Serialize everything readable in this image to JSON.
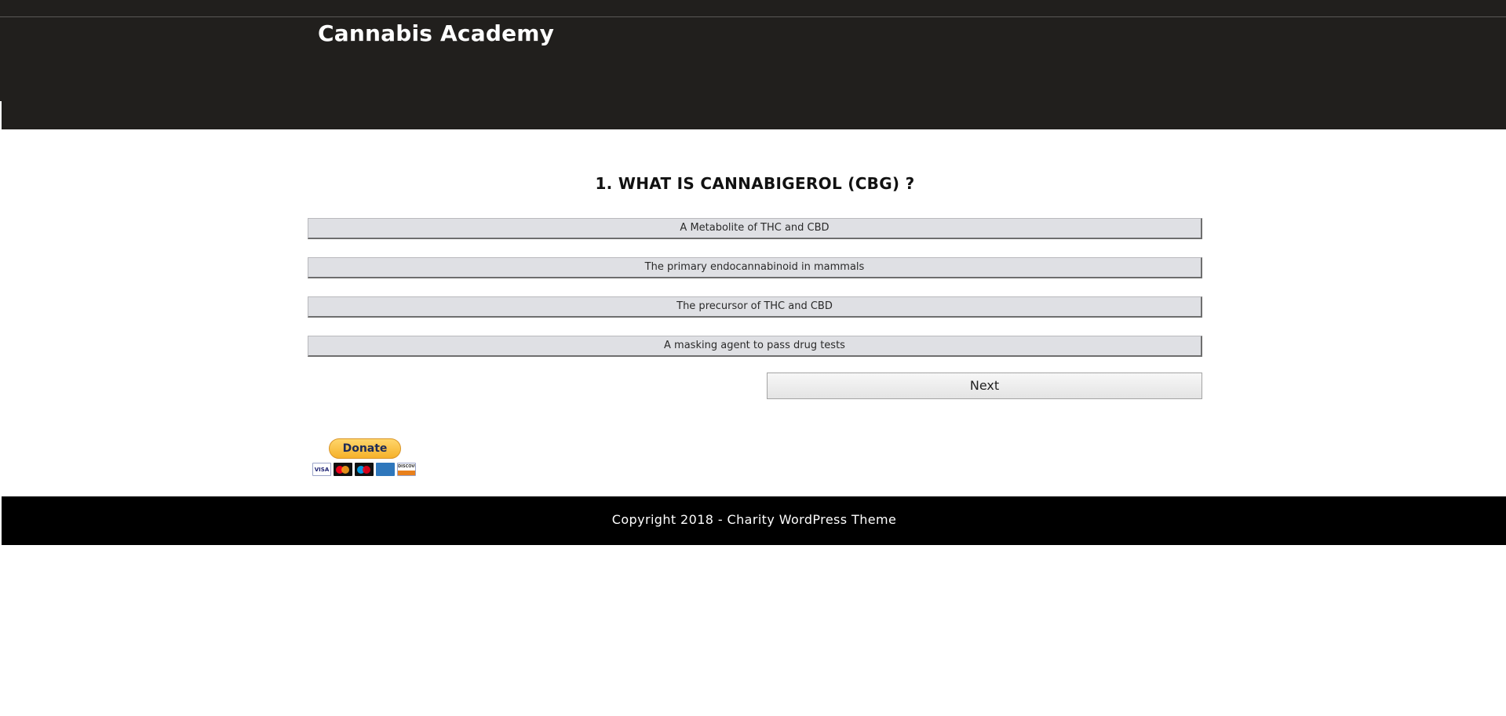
{
  "site": {
    "title": "Cannabis Academy"
  },
  "quiz": {
    "question": "1. WHAT IS CANNABIGEROL (CBG) ?",
    "answers": [
      "A Metabolite of THC and CBD",
      "The primary endocannabinoid in mammals",
      "The precursor of THC and CBD",
      "A masking agent to pass drug tests"
    ],
    "next_label": "Next"
  },
  "donate": {
    "button_label": "Donate",
    "cards": [
      "visa-icon",
      "mastercard-icon",
      "maestro-icon",
      "amex-icon",
      "discover-icon"
    ],
    "card_labels": {
      "visa": "VISA",
      "discover": "DISCOVER"
    }
  },
  "footer": {
    "copyright": "Copyright 2018 - Charity WordPress Theme"
  },
  "colors": {
    "header_bg": "#211f1d",
    "footer_bg": "#000000",
    "answer_bg": "#dfe0e4",
    "donate_yellow": "#f5b12a"
  }
}
